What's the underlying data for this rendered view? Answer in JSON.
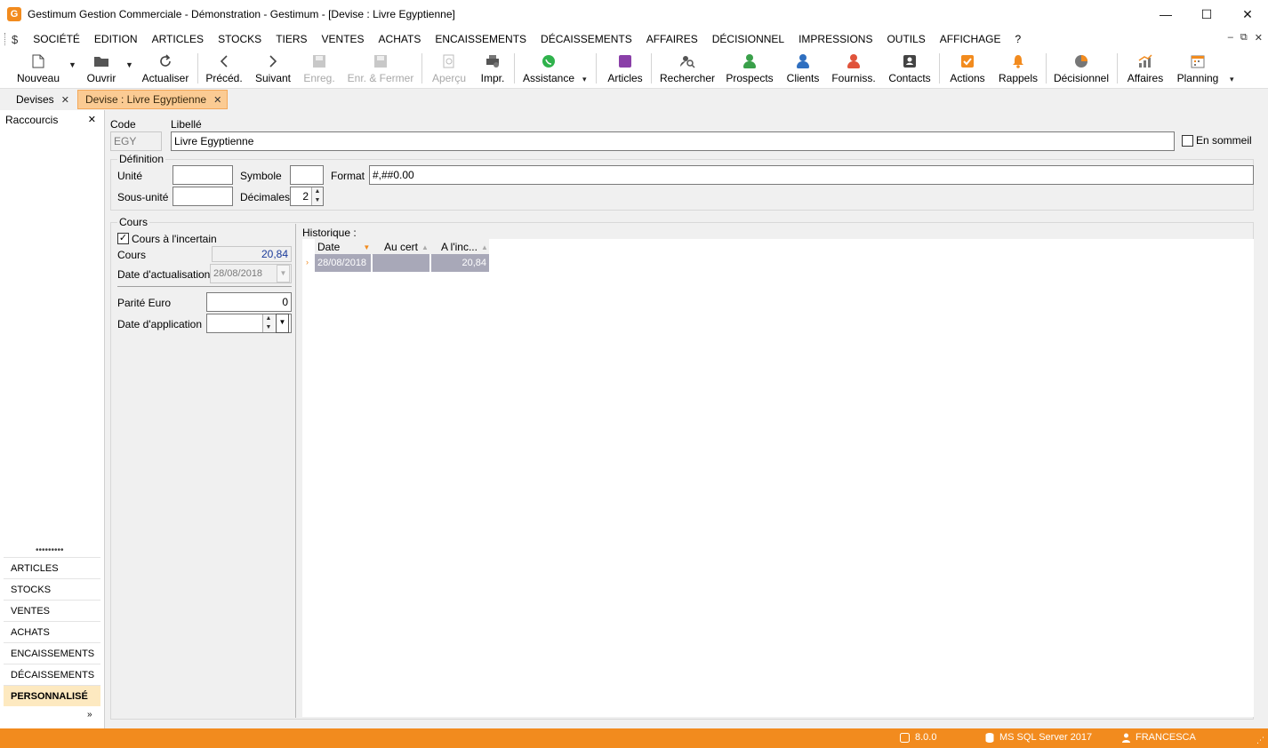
{
  "window": {
    "title": "Gestimum Gestion Commerciale - Démonstration - Gestimum - [Devise : Livre Egyptienne]",
    "logo_letter": "G",
    "min": "—",
    "max": "☐",
    "close": "✕"
  },
  "menu": {
    "dollar": "$",
    "items": [
      "SOCIÉTÉ",
      "EDITION",
      "ARTICLES",
      "STOCKS",
      "TIERS",
      "VENTES",
      "ACHATS",
      "ENCAISSEMENTS",
      "DÉCAISSEMENTS",
      "AFFAIRES",
      "DÉCISIONNEL",
      "IMPRESSIONS",
      "OUTILS",
      "AFFICHAGE",
      "?"
    ],
    "right": [
      "–",
      "⧉",
      "✕"
    ]
  },
  "toolbar": {
    "nouveau": "Nouveau",
    "ouvrir": "Ouvrir",
    "actualiser": "Actualiser",
    "preced": "Précéd.",
    "suivant": "Suivant",
    "enreg": "Enreg.",
    "enr_fermer": "Enr. & Fermer",
    "apercu": "Aperçu",
    "impr": "Impr.",
    "assistance": "Assistance",
    "articles": "Articles",
    "rechercher": "Rechercher",
    "prospects": "Prospects",
    "clients": "Clients",
    "fourniss": "Fourniss.",
    "contacts": "Contacts",
    "actions": "Actions",
    "rappels": "Rappels",
    "decisionnel": "Décisionnel",
    "affaires": "Affaires",
    "planning": "Planning"
  },
  "tabs": {
    "devises": "Devises",
    "devise_active": "Devise : Livre Egyptienne",
    "close": "✕"
  },
  "sidebar": {
    "title": "Raccourcis",
    "close": "✕",
    "dots": "•••••••••",
    "items": [
      "ARTICLES",
      "STOCKS",
      "VENTES",
      "ACHATS",
      "ENCAISSEMENTS",
      "DÉCAISSEMENTS",
      "PERSONNALISÉ"
    ],
    "more": "»"
  },
  "form": {
    "code_label": "Code",
    "code_value": "EGY",
    "libelle_label": "Libellé",
    "libelle_value": "Livre Egyptienne",
    "sommeil_label": "En sommeil",
    "definition_title": "Définition",
    "unite_label": "Unité",
    "unite_value": "",
    "symbole_label": "Symbole",
    "symbole_value": "",
    "format_label": "Format",
    "format_value": "#,##0.00",
    "sousunite_label": "Sous-unité",
    "sousunite_value": "",
    "decimales_label": "Décimales",
    "decimales_value": "2",
    "cours_title": "Cours",
    "incertain_label": "Cours à l'incertain",
    "cours_label": "Cours",
    "cours_value": "20,84",
    "date_actu_label": "Date d'actualisation",
    "date_actu_value": "28/08/2018",
    "parite_label": "Parité Euro",
    "parite_value": "0",
    "date_app_label": "Date d'application",
    "date_app_value": ""
  },
  "historique": {
    "title": "Historique :",
    "columns": [
      "Date",
      "Au cert",
      "A l'inc..."
    ],
    "rows": [
      {
        "date": "28/08/2018",
        "au_cert": "",
        "a_linc": "20,84"
      }
    ]
  },
  "status": {
    "version": "8.0.0",
    "db": "MS SQL Server 2017",
    "user": "FRANCESCA"
  },
  "colors": {
    "accent": "#f28b1e",
    "tab_active": "#fbcb93",
    "grid_selected": "#a8a8b8"
  }
}
